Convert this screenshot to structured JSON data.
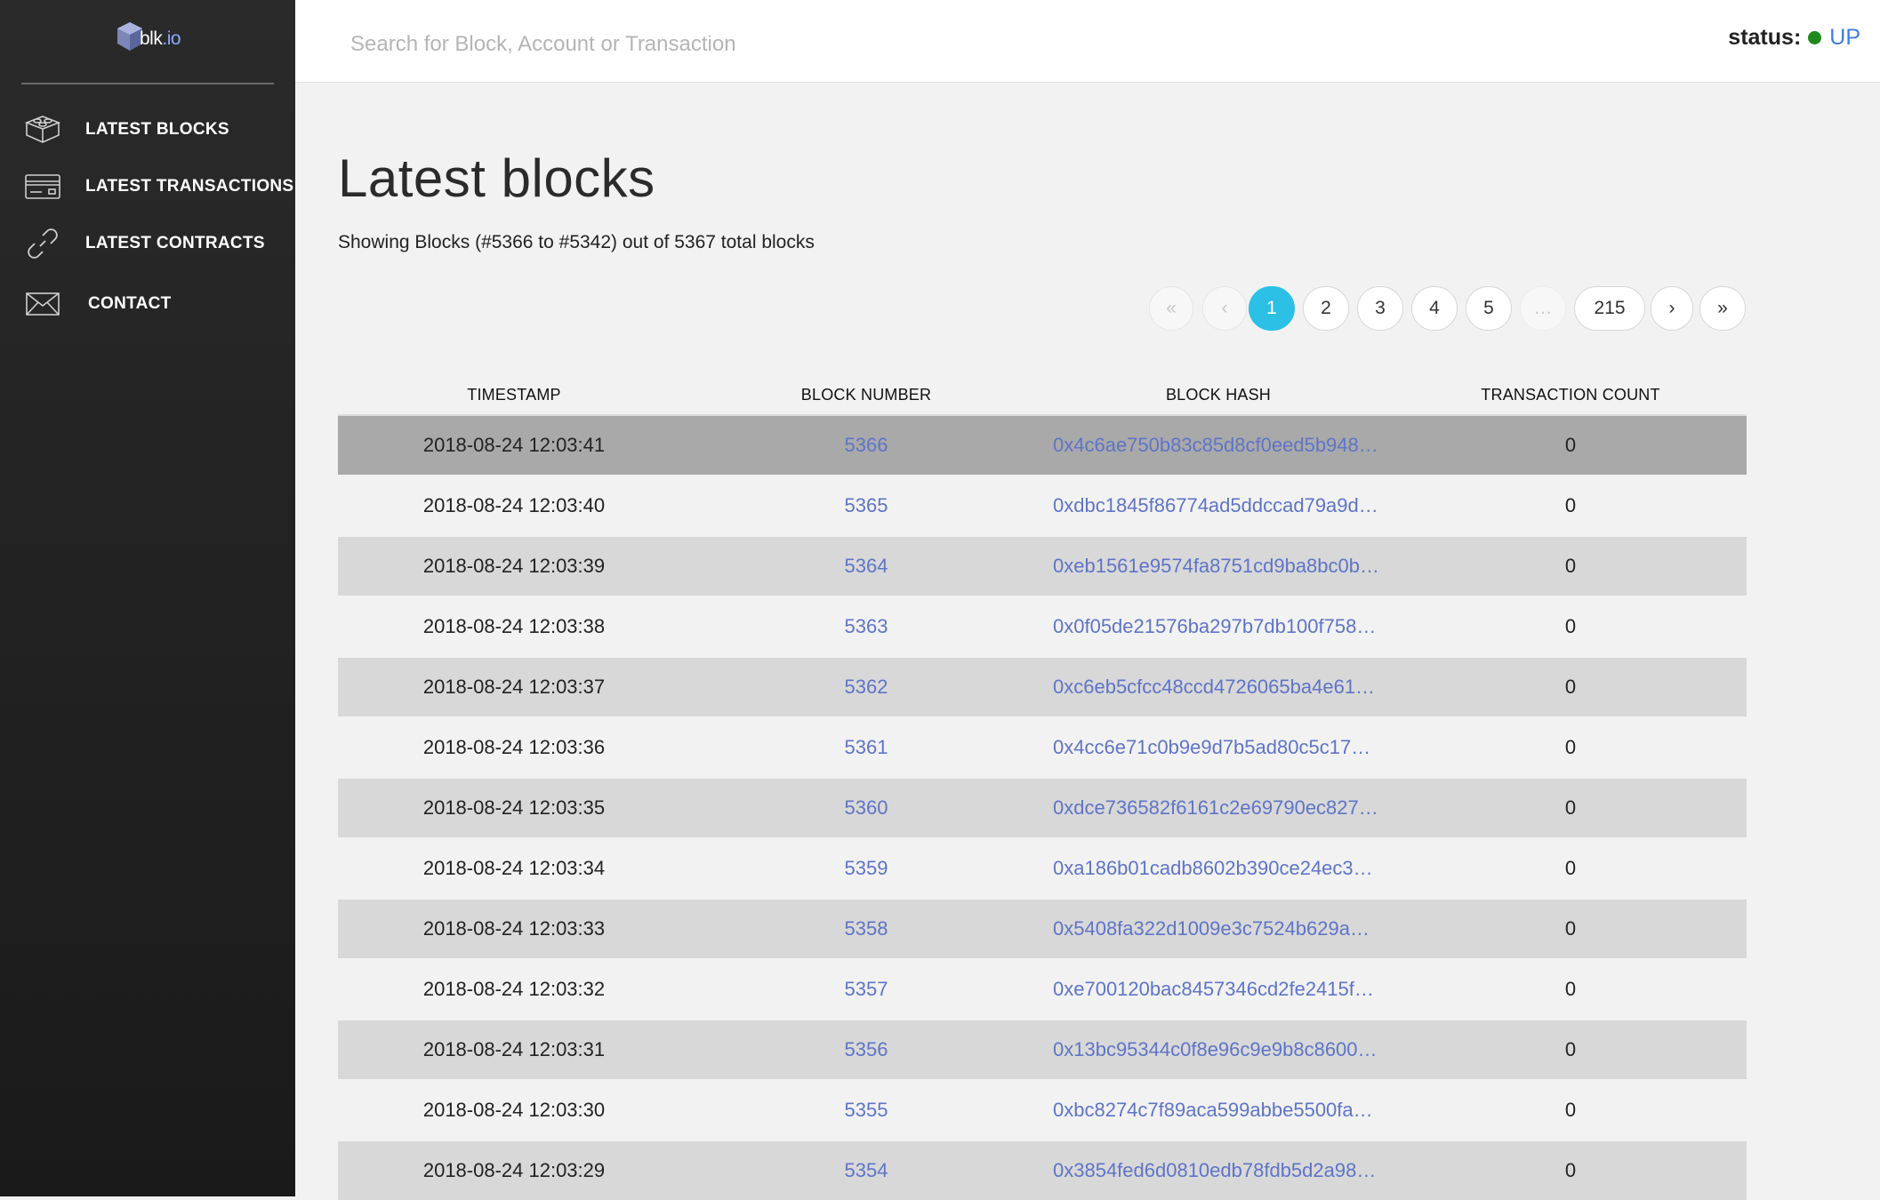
{
  "brand": {
    "name": "blk",
    "dot": ".",
    "tld": "io"
  },
  "sidebar": {
    "items": [
      {
        "label": "LATEST BLOCKS",
        "icon": "blocks-icon"
      },
      {
        "label": "LATEST TRANSACTIONS",
        "icon": "card-icon"
      },
      {
        "label": "LATEST CONTRACTS",
        "icon": "link-icon"
      },
      {
        "label": "CONTACT",
        "icon": "envelope-icon"
      }
    ]
  },
  "header": {
    "search_placeholder": "Search for Block, Account or Transaction",
    "status_label": "status",
    "status_colon": ":",
    "status_value": "UP",
    "status_color": "#1e8a1e"
  },
  "main": {
    "title": "Latest blocks",
    "summary": "Showing Blocks (#5366 to #5342) out of 5367 total blocks"
  },
  "pagination": {
    "first": "«",
    "prev": "‹",
    "ellipsis": "…",
    "next": "›",
    "last": "»",
    "pages": [
      "1",
      "2",
      "3",
      "4",
      "5"
    ],
    "last_page": "215",
    "current": "1",
    "accent": "#2cc0e6"
  },
  "table": {
    "columns": [
      "TIMESTAMP",
      "BLOCK NUMBER",
      "BLOCK HASH",
      "TRANSACTION COUNT"
    ],
    "rows": [
      {
        "timestamp": "2018-08-24 12:03:41",
        "number": "5366",
        "hash": "0x4c6ae750b83c85d8cf0eed5b948…",
        "tx_count": "0"
      },
      {
        "timestamp": "2018-08-24 12:03:40",
        "number": "5365",
        "hash": "0xdbc1845f86774ad5ddccad79a9d…",
        "tx_count": "0"
      },
      {
        "timestamp": "2018-08-24 12:03:39",
        "number": "5364",
        "hash": "0xeb1561e9574fa8751cd9ba8bc0b…",
        "tx_count": "0"
      },
      {
        "timestamp": "2018-08-24 12:03:38",
        "number": "5363",
        "hash": "0x0f05de21576ba297b7db100f758…",
        "tx_count": "0"
      },
      {
        "timestamp": "2018-08-24 12:03:37",
        "number": "5362",
        "hash": "0xc6eb5cfcc48ccd4726065ba4e61…",
        "tx_count": "0"
      },
      {
        "timestamp": "2018-08-24 12:03:36",
        "number": "5361",
        "hash": "0x4cc6e71c0b9e9d7b5ad80c5c17…",
        "tx_count": "0"
      },
      {
        "timestamp": "2018-08-24 12:03:35",
        "number": "5360",
        "hash": "0xdce736582f6161c2e69790ec827…",
        "tx_count": "0"
      },
      {
        "timestamp": "2018-08-24 12:03:34",
        "number": "5359",
        "hash": "0xa186b01cadb8602b390ce24ec3…",
        "tx_count": "0"
      },
      {
        "timestamp": "2018-08-24 12:03:33",
        "number": "5358",
        "hash": "0x5408fa322d1009e3c7524b629a…",
        "tx_count": "0"
      },
      {
        "timestamp": "2018-08-24 12:03:32",
        "number": "5357",
        "hash": "0xe700120bac8457346cd2fe2415f…",
        "tx_count": "0"
      },
      {
        "timestamp": "2018-08-24 12:03:31",
        "number": "5356",
        "hash": "0x13bc95344c0f8e96c9e9b8c8600…",
        "tx_count": "0"
      },
      {
        "timestamp": "2018-08-24 12:03:30",
        "number": "5355",
        "hash": "0xbc8274c7f89aca599abbe5500fa…",
        "tx_count": "0"
      },
      {
        "timestamp": "2018-08-24 12:03:29",
        "number": "5354",
        "hash": "0x3854fed6d0810edb78fdb5d2a98…",
        "tx_count": "0"
      }
    ]
  },
  "colors": {
    "link": "#5f74c8",
    "sidebar": "#222222"
  }
}
